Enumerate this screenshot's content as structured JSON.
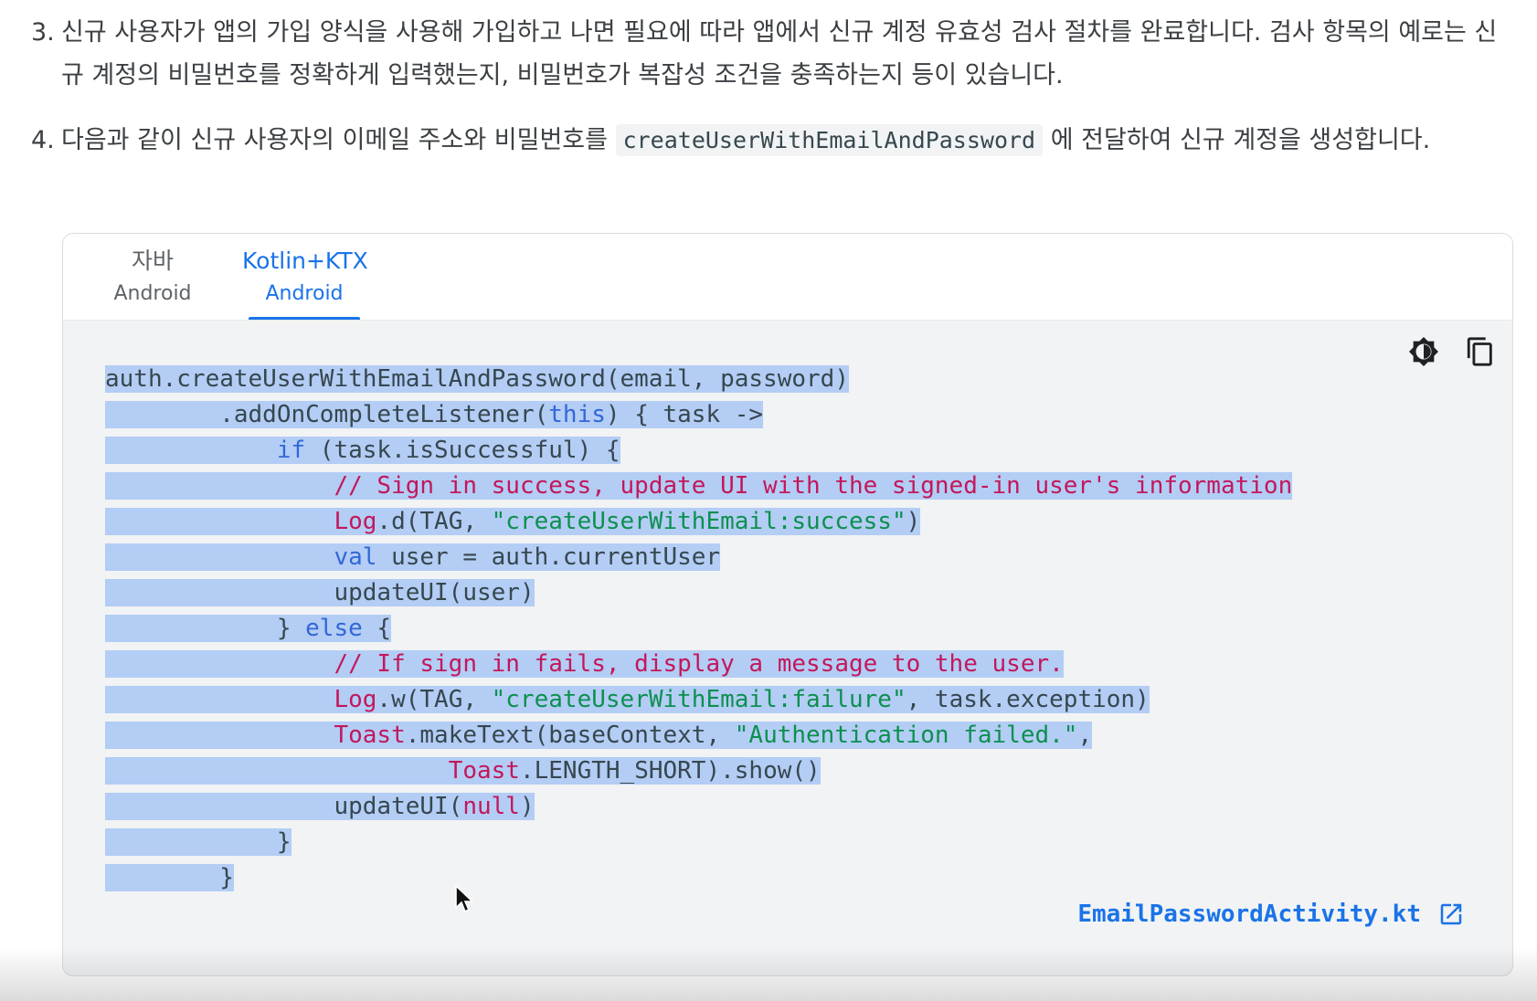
{
  "steps": [
    {
      "number": "3.",
      "text": "신규 사용자가 앱의 가입 양식을 사용해 가입하고 나면 필요에 따라 앱에서 신규 계정 유효성 검사 절차를 완료합니다. 검사 항목의 예로는 신규 계정의 비밀번호를 정확하게 입력했는지, 비밀번호가 복잡성 조건을 충족하는지 등이 있습니다."
    },
    {
      "number": "4.",
      "text_before": "다음과 같이 신규 사용자의 이메일 주소와 비밀번호를 ",
      "code": "createUserWithEmailAndPassword",
      "text_after": " 에 전달하여 신규 계정을 생성합니다."
    }
  ],
  "tabs": [
    {
      "label": "자바",
      "sublabel": "Android",
      "active": false
    },
    {
      "label": "Kotlin+KTX",
      "sublabel": "Android",
      "active": true
    }
  ],
  "code_lines": [
    [
      {
        "t": "auth.createUserWithEmailAndPassword(email, password)"
      }
    ],
    [
      {
        "t": "        .addOnCompleteListener("
      },
      {
        "t": "this",
        "c": "kw"
      },
      {
        "t": ") { task ->"
      }
    ],
    [
      {
        "t": "            "
      },
      {
        "t": "if",
        "c": "kw"
      },
      {
        "t": " (task.isSuccessful) {"
      }
    ],
    [
      {
        "t": "                "
      },
      {
        "t": "// Sign in success, update UI with the signed-in user's information",
        "c": "cm"
      }
    ],
    [
      {
        "t": "                "
      },
      {
        "t": "Log",
        "c": "cls"
      },
      {
        "t": ".d(TAG, "
      },
      {
        "t": "\"createUserWithEmail:success\"",
        "c": "str"
      },
      {
        "t": ")"
      }
    ],
    [
      {
        "t": "                "
      },
      {
        "t": "val",
        "c": "kw"
      },
      {
        "t": " user = auth.currentUser"
      }
    ],
    [
      {
        "t": "                updateUI(user)"
      }
    ],
    [
      {
        "t": "            } "
      },
      {
        "t": "else",
        "c": "kw"
      },
      {
        "t": " {"
      }
    ],
    [
      {
        "t": "                "
      },
      {
        "t": "// If sign in fails, display a message to the user.",
        "c": "cm"
      }
    ],
    [
      {
        "t": "                "
      },
      {
        "t": "Log",
        "c": "cls"
      },
      {
        "t": ".w(TAG, "
      },
      {
        "t": "\"createUserWithEmail:failure\"",
        "c": "str"
      },
      {
        "t": ", task.exception)"
      }
    ],
    [
      {
        "t": "                "
      },
      {
        "t": "Toast",
        "c": "cls"
      },
      {
        "t": ".makeText(baseContext, "
      },
      {
        "t": "\"Authentication failed.\"",
        "c": "str"
      },
      {
        "t": ","
      }
    ],
    [
      {
        "t": "                        "
      },
      {
        "t": "Toast",
        "c": "cls"
      },
      {
        "t": ".LENGTH_SHORT).show()"
      }
    ],
    [
      {
        "t": "                updateUI("
      },
      {
        "t": "null",
        "c": "cls"
      },
      {
        "t": ")"
      }
    ],
    [
      {
        "t": "            }"
      }
    ],
    [
      {
        "t": "        }"
      }
    ]
  ],
  "toolbar": {
    "theme_icon": "brightness-icon",
    "copy_icon": "copy-icon"
  },
  "file_link": {
    "label": "EmailPasswordActivity.kt",
    "icon": "open-in-new-icon"
  },
  "colors": {
    "accent": "#1a73e8",
    "selection": "#b3cdf5",
    "code_bg": "#f1f3f4",
    "keyword": "#3367d6",
    "class": "#c2185b",
    "string": "#0d904f",
    "comment": "#c2185b"
  }
}
